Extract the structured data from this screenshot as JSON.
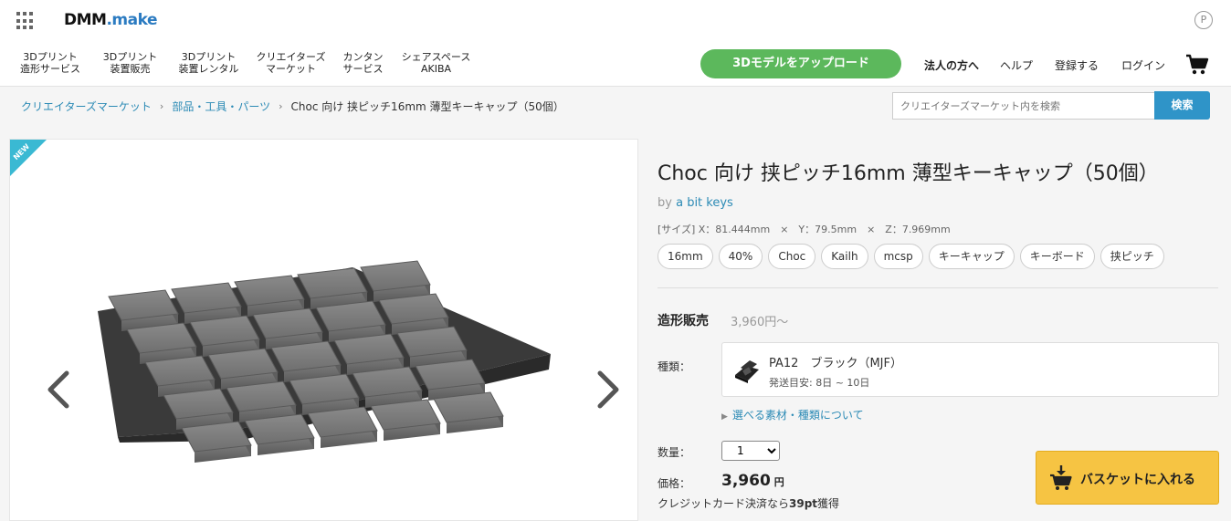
{
  "header": {
    "logo_main": "DMM",
    "logo_suffix": ".make",
    "point_icon_label": "P",
    "nav": [
      {
        "line1": "3Dプリント",
        "line2": "造形サービス"
      },
      {
        "line1": "3Dプリント",
        "line2": "装置販売"
      },
      {
        "line1": "3Dプリント",
        "line2": "装置レンタル"
      },
      {
        "line1": "クリエイターズ",
        "line2": "マーケット"
      },
      {
        "line1": "カンタン",
        "line2": "サービス"
      },
      {
        "line1": "シェアスペース",
        "line2": "AKIBA"
      }
    ],
    "upload_label": "3Dモデルをアップロード",
    "corporate_label": "法人の方へ",
    "help_label": "ヘルプ",
    "register_label": "登録する",
    "login_label": "ログイン"
  },
  "breadcrumb": {
    "items": [
      "クリエイターズマーケット",
      "部品・工具・パーツ"
    ],
    "current": "Choc 向け 挟ピッチ16mm 薄型キーキャップ（50個）"
  },
  "search": {
    "placeholder": "クリエイターズマーケット内を検索",
    "button_label": "検索"
  },
  "image": {
    "badge": "NEW"
  },
  "product": {
    "title": "Choc 向け 挟ピッチ16mm 薄型キーキャップ（50個）",
    "by": "by",
    "author": "a bit keys",
    "size_line": "[サイズ] X：81.444mm　×　Y：79.5mm　×　Z：7.969mm",
    "tags": [
      "16mm",
      "40%",
      "Choc",
      "Kailh",
      "mcsp",
      "キーキャップ",
      "キーボード",
      "挟ピッチ"
    ]
  },
  "purchase": {
    "section_title": "造形販売",
    "section_price": "3,960円〜",
    "material_label": "種類：",
    "material_name": "PA12　ブラック（MJF）",
    "material_shipping": "発送目安: 8日 ~ 10日",
    "material_link": "選べる素材・種類について",
    "quantity_label": "数量：",
    "quantity_value": "1",
    "price_label": "価格：",
    "price_value": "3,960",
    "price_unit": "円",
    "credit_prefix": "クレジットカード決済なら",
    "credit_points": "39pt",
    "credit_suffix": "獲得",
    "basket_label": "バスケットに入れる"
  },
  "colors": {
    "accent_blue": "#2b8ab5",
    "upload_green": "#5cb85c",
    "basket_yellow": "#f6c443",
    "new_badge": "#3ab9d3"
  }
}
